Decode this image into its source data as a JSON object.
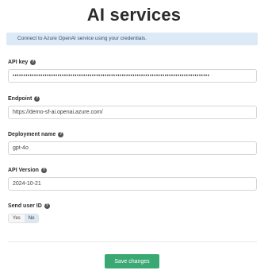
{
  "page": {
    "title": "AI services",
    "info": "Connect to Azure OpenAI service using your credentials."
  },
  "fields": {
    "api_key": {
      "label": "API key",
      "value": "••••••••••••••••••••••••••••••••••••••••••••••••••••••••••••••••••••••••••••••••••••••••••••"
    },
    "endpoint": {
      "label": "Endpoint",
      "value": "https://demo-sf-ai.openai.azure.com/"
    },
    "deployment": {
      "label": "Deployment name",
      "value": "gpt-4o"
    },
    "api_version": {
      "label": "API Version",
      "value": "2024-10-21"
    },
    "send_user_id": {
      "label": "Send user ID",
      "options": [
        "Yes",
        "No"
      ],
      "selected": "No"
    }
  },
  "help_icon_glyph": "?",
  "actions": {
    "save_label": "Save changes"
  },
  "colors": {
    "accent": "#3aa873",
    "info_bg": "#dce9f6",
    "toggle_selected": "#dde8f3"
  }
}
